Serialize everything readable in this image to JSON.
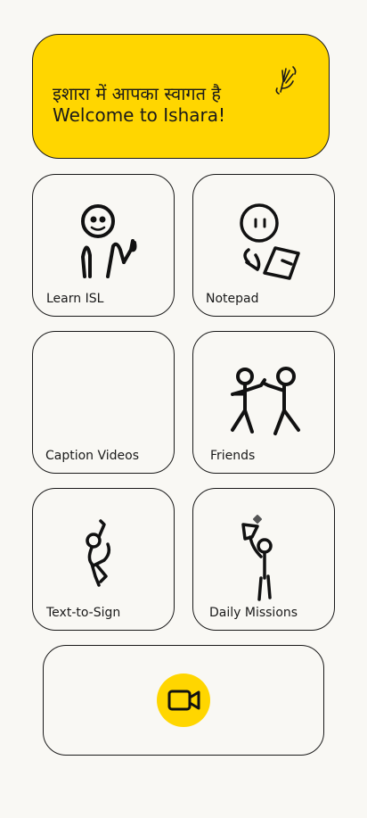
{
  "colors": {
    "accent": "#ffd600",
    "background": "#f9f8f4",
    "ink": "#1a1a1a"
  },
  "banner": {
    "hindi_greeting": "इशारा में आपका स्वागत है",
    "english_greeting": "Welcome to Ishara!",
    "icon": "waving-hand-icon"
  },
  "cards": [
    {
      "label": "Learn ISL",
      "icon": "stick-figure-thumbs-up-icon"
    },
    {
      "label": "Notepad",
      "icon": "stick-figure-writing-icon"
    },
    {
      "label": "Caption Videos",
      "icon": ""
    },
    {
      "label": "Friends",
      "icon": "two-stick-figures-icon"
    },
    {
      "label": "Text-to-Sign",
      "icon": "stick-figure-jumping-icon"
    },
    {
      "label": "Daily Missions",
      "icon": "stick-figure-flag-icon"
    }
  ],
  "video_action": {
    "icon": "video-camera-icon"
  }
}
